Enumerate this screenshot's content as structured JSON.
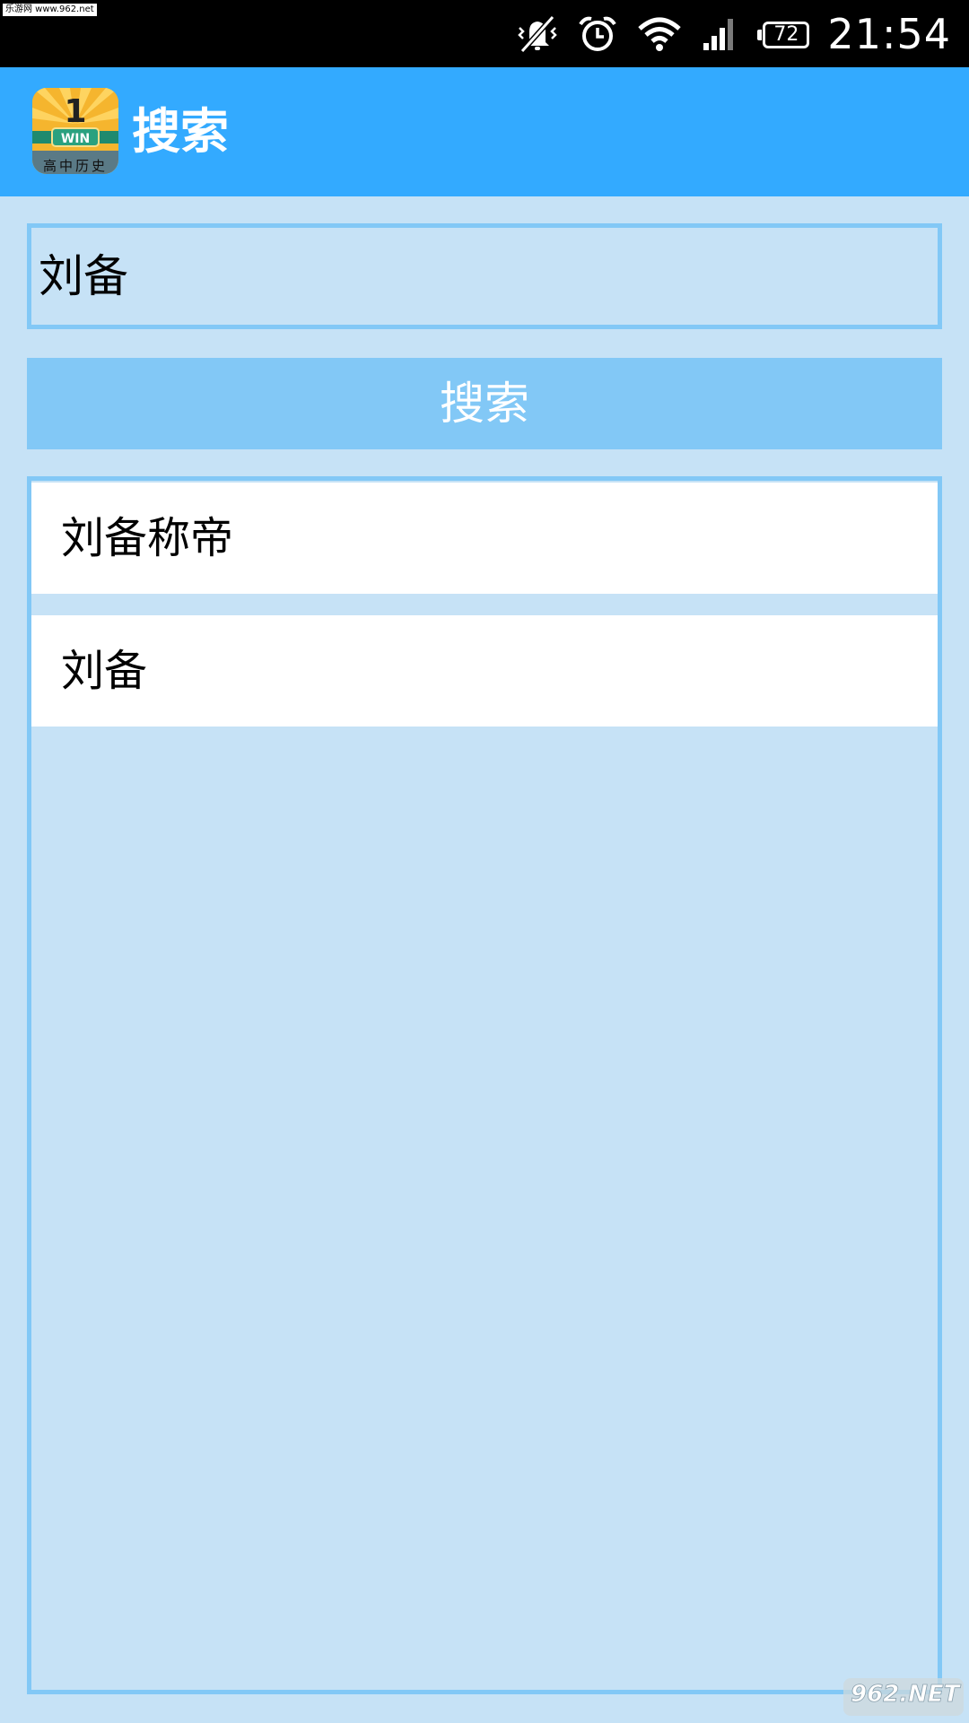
{
  "status_bar": {
    "watermark": "乐游网 www.962.net",
    "battery_level": "72",
    "time": "21:54",
    "icons": [
      "vibrate-off-icon",
      "alarm-icon",
      "wifi-icon",
      "signal-icon",
      "battery-icon"
    ]
  },
  "app_bar": {
    "title": "搜索",
    "app_icon": {
      "name": "app-logo-icon",
      "label_top": "1",
      "label_mid": "WIN",
      "label_bottom": "高中历史"
    }
  },
  "search": {
    "query": "刘备",
    "button_label": "搜索"
  },
  "results": [
    {
      "label": "刘备称帝"
    },
    {
      "label": "刘备"
    }
  ],
  "watermark_bottom": "962.NET 乐游网",
  "colors": {
    "status_bar": "#000000",
    "app_bar": "#33aaff",
    "background": "#c6e2f6",
    "accent_border": "#82c8f6",
    "button": "#82c8f6",
    "list_item": "#ffffff"
  }
}
